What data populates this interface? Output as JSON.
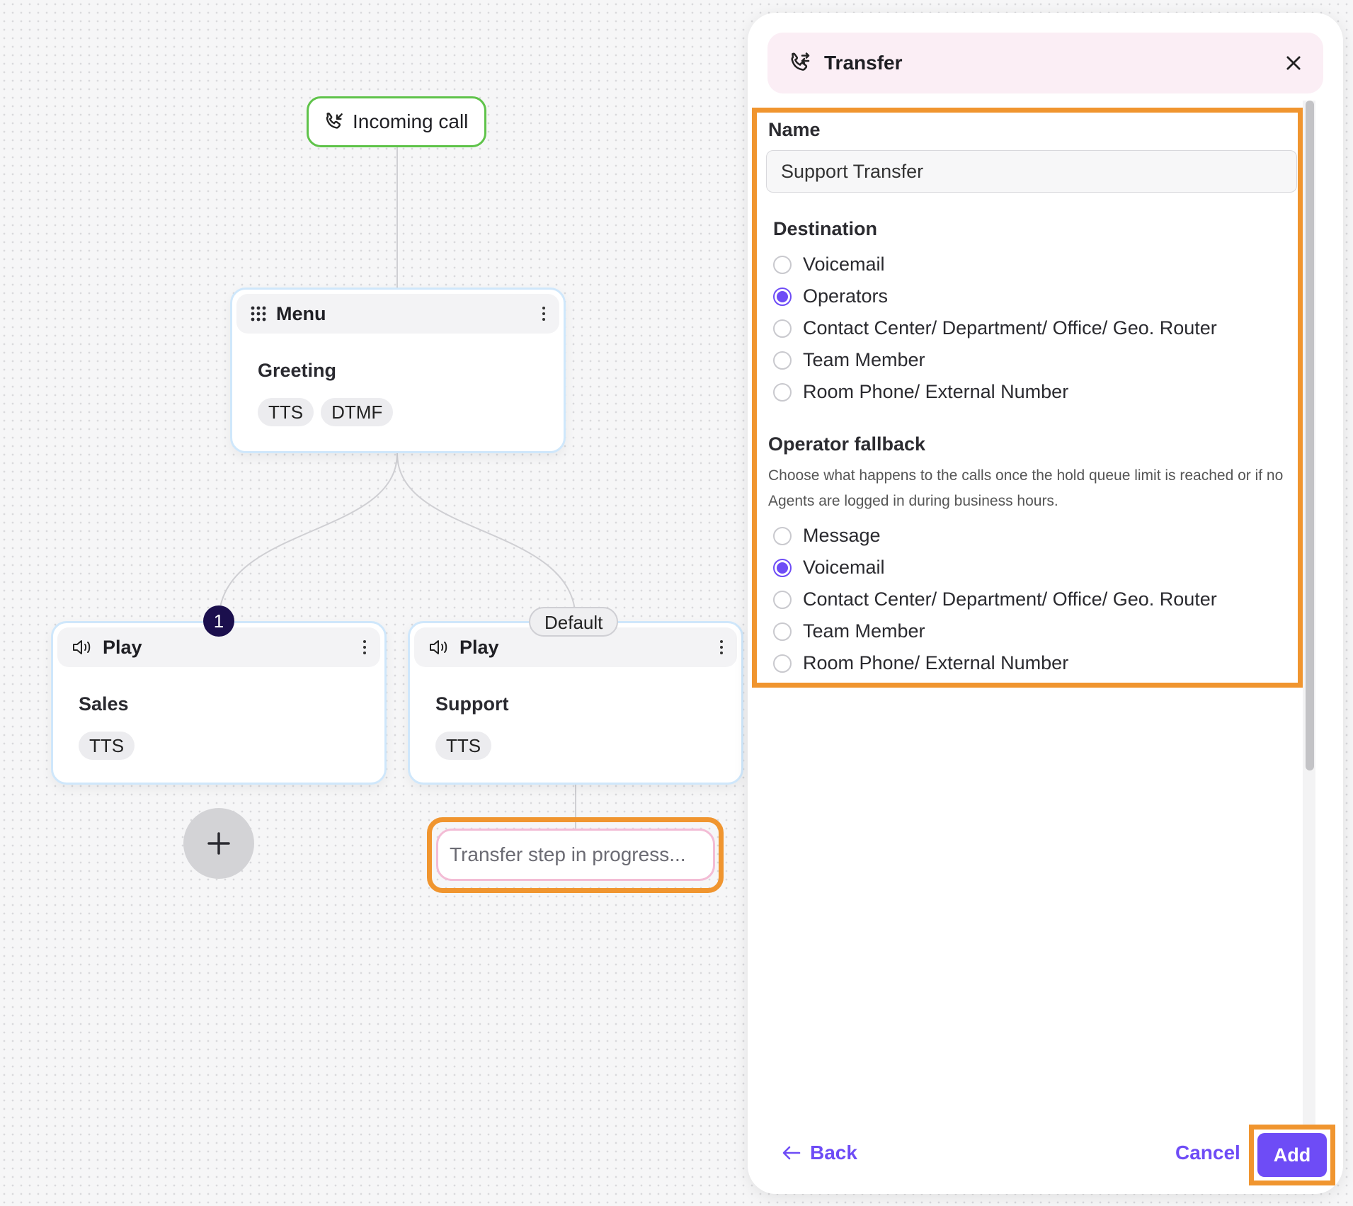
{
  "canvas": {
    "incoming": {
      "label": "Incoming call"
    },
    "menu": {
      "header": "Menu",
      "title": "Greeting",
      "tags": [
        "TTS",
        "DTMF"
      ]
    },
    "play_sales": {
      "header": "Play",
      "title": "Sales",
      "tags": [
        "TTS"
      ],
      "branch_label": "1"
    },
    "play_support": {
      "header": "Play",
      "title": "Support",
      "tags": [
        "TTS"
      ],
      "branch_label": "Default"
    },
    "transfer_placeholder": "Transfer step in progress..."
  },
  "panel": {
    "title": "Transfer",
    "name_label": "Name",
    "name_value": "Support Transfer",
    "destination_label": "Destination",
    "destination_options": [
      {
        "label": "Voicemail",
        "selected": false
      },
      {
        "label": "Operators",
        "selected": true
      },
      {
        "label": "Contact Center/ Department/ Office/ Geo. Router",
        "selected": false
      },
      {
        "label": "Team Member",
        "selected": false
      },
      {
        "label": "Room Phone/ External Number",
        "selected": false
      }
    ],
    "fallback_label": "Operator fallback",
    "fallback_help": "Choose what happens to the calls once the hold queue limit is reached or if no Agents are logged in during business hours.",
    "fallback_options": [
      {
        "label": "Message",
        "selected": false
      },
      {
        "label": "Voicemail",
        "selected": true
      },
      {
        "label": "Contact Center/ Department/ Office/ Geo. Router",
        "selected": false
      },
      {
        "label": "Team Member",
        "selected": false
      },
      {
        "label": "Room Phone/ External Number",
        "selected": false
      }
    ],
    "back_label": "Back",
    "cancel_label": "Cancel",
    "add_label": "Add"
  },
  "colors": {
    "accent": "#6e4cf6",
    "highlight": "#f0952f",
    "start_node": "#5fc34a"
  }
}
